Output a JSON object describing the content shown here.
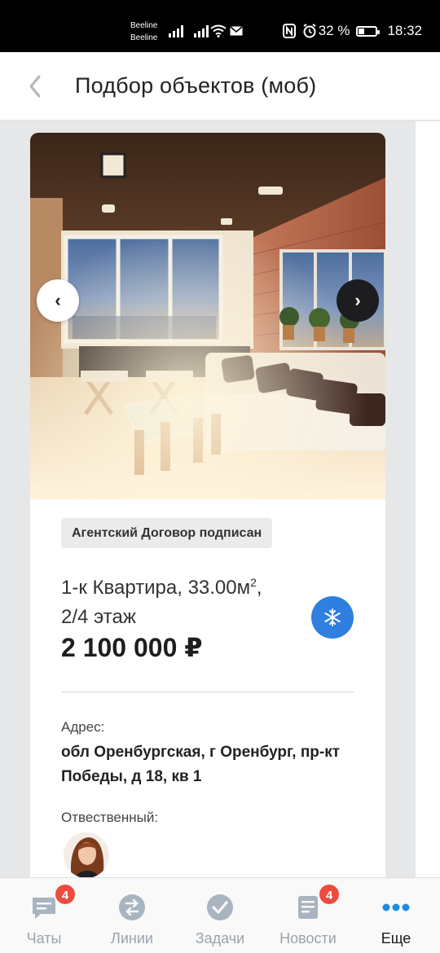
{
  "status_bar": {
    "carrier_1": "Beeline",
    "carrier_2": "Beeline",
    "battery": "32 %",
    "time": "18:32"
  },
  "header": {
    "title": "Подбор объектов (моб)"
  },
  "listing": {
    "gallery": {
      "prev_label": "‹",
      "next_label": "›"
    },
    "status_badge": "Агентский Договор подписан",
    "title_line1": "1-к Квартира, 33.00м",
    "title_sup": "2",
    "title_line1_end": ",",
    "title_line2": "2/4 этаж",
    "price": "2 100 000 ₽",
    "address_label": "Адрес:",
    "address": "обл Оренбургская, г Оренбург, пр-кт Победы, д 18, кв 1",
    "responsible_label": "Отвественный:",
    "accent_color": "#2f7fe0"
  },
  "bottom_nav": {
    "tabs": [
      {
        "label": "Чаты",
        "icon": "chat-icon",
        "count": "4"
      },
      {
        "label": "Линии",
        "icon": "lines-icon"
      },
      {
        "label": "Задачи",
        "icon": "check-icon"
      },
      {
        "label": "Новости",
        "icon": "news-icon",
        "count": "4"
      },
      {
        "label": "Еще",
        "icon": "more-icon",
        "active": true
      }
    ],
    "badge_color": "#f04a3e",
    "active_color": "#1e8fe0"
  }
}
